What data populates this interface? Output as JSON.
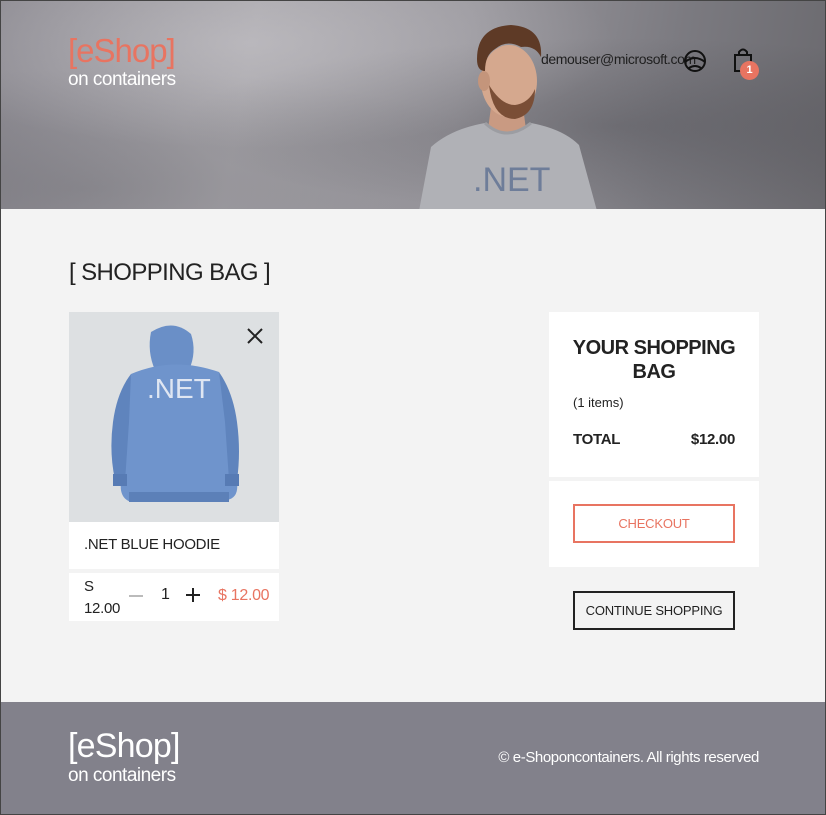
{
  "header": {
    "logo_brand": "[eShop]",
    "logo_sub": "on containers",
    "user_email": "demouser@microsoft.com",
    "user_icon": "user-avatar-icon",
    "cart_icon": "shopping-bag-icon",
    "cart_count": "1",
    "hero_shirt_text": ".NET"
  },
  "main": {
    "title": "[ SHOPPING BAG ]",
    "items": [
      {
        "name": ".NET BLUE HOODIE",
        "image_text": ".NET",
        "size_label": "S",
        "unit_price": "12.00",
        "quantity": "1",
        "price": "$ 12.00"
      }
    ],
    "summary": {
      "title": "YOUR SHOPPING BAG",
      "count": "(1 items)",
      "total_label": "TOTAL",
      "total_value": "$12.00",
      "checkout_label": "CHECKOUT"
    },
    "continue_label": "CONTINUE SHOPPING"
  },
  "footer": {
    "logo_brand": "[eShop]",
    "logo_sub": "on containers",
    "copyright": "© e-Shoponcontainers. All rights reserved"
  },
  "colors": {
    "accent": "#e87461",
    "background": "#f3f3f3",
    "footer": "#82818b"
  }
}
